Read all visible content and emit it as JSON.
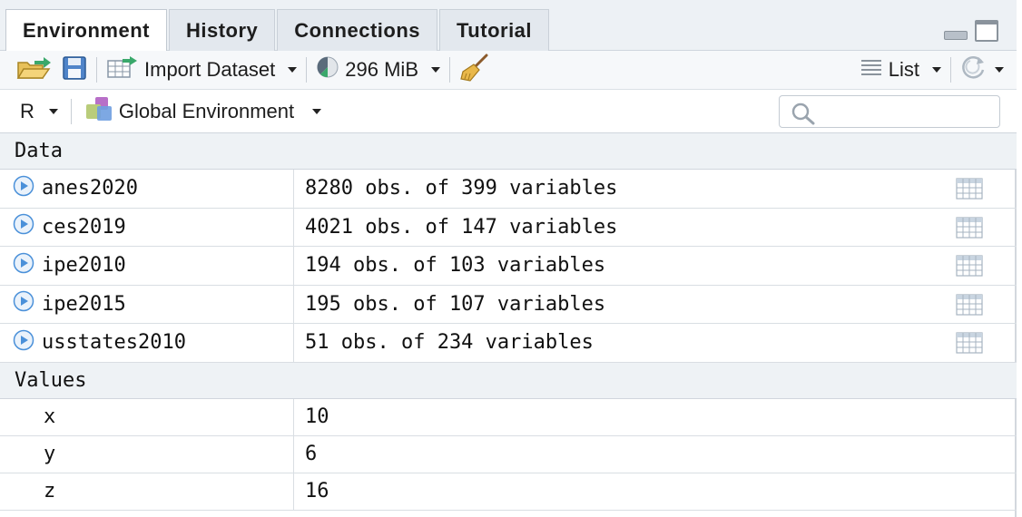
{
  "tabs": [
    {
      "label": "Environment",
      "active": true
    },
    {
      "label": "History"
    },
    {
      "label": "Connections"
    },
    {
      "label": "Tutorial"
    }
  ],
  "toolbar": {
    "open_icon": "folder-open-icon",
    "save_icon": "save-disk-icon",
    "import_label": "Import Dataset",
    "memory_label": "296 MiB",
    "broom_icon": "broom-icon",
    "view_label": "List",
    "refresh_icon": "refresh-icon"
  },
  "env_bar": {
    "language": "R",
    "environment": "Global Environment",
    "search_placeholder": ""
  },
  "sections": {
    "data_header": "Data",
    "values_header": "Values"
  },
  "data_rows": [
    {
      "name": "anes2020",
      "value": "8280 obs. of 399 variables"
    },
    {
      "name": "ces2019",
      "value": "4021 obs. of 147 variables"
    },
    {
      "name": "ipe2010",
      "value": "194 obs. of 103 variables"
    },
    {
      "name": "ipe2015",
      "value": "195 obs. of 107 variables"
    },
    {
      "name": "usstates2010",
      "value": "51 obs. of 234 variables"
    }
  ],
  "value_rows": [
    {
      "name": "x",
      "value": "10"
    },
    {
      "name": "y",
      "value": "6"
    },
    {
      "name": "z",
      "value": "16"
    }
  ],
  "colors": {
    "accent_blue": "#4a90d9",
    "panel_bg": "#edf1f5"
  }
}
